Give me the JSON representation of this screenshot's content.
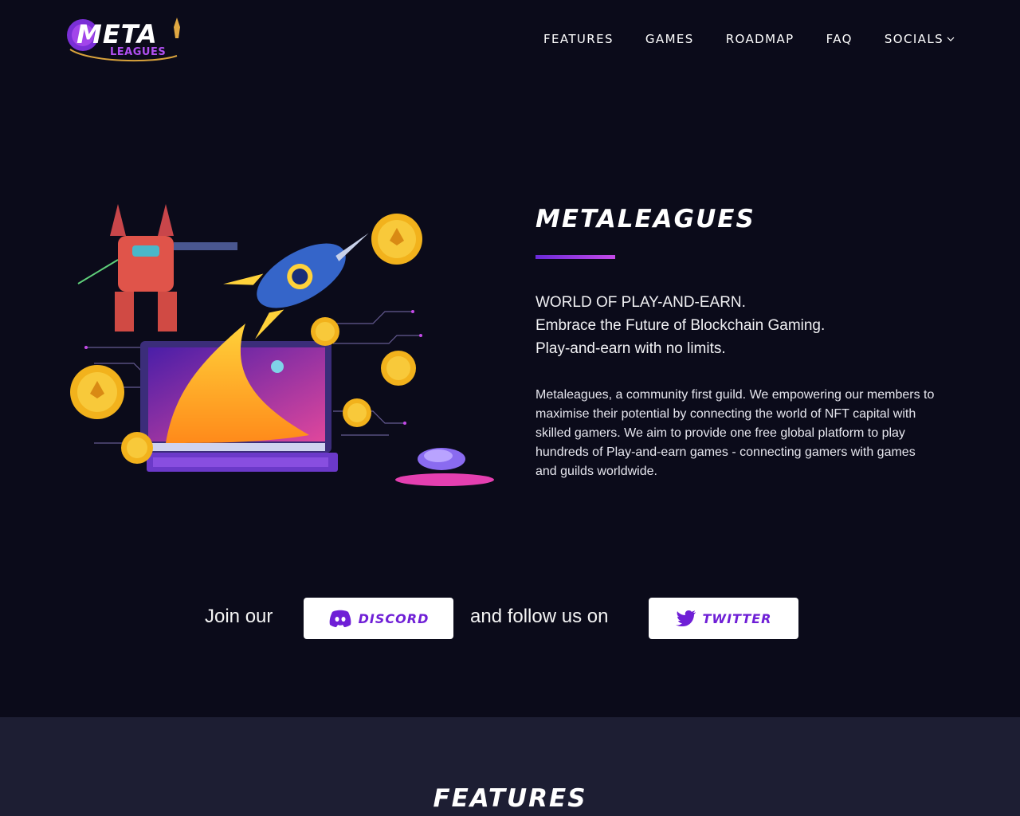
{
  "brand": {
    "name_main": "META",
    "name_sub": "LEAGUES"
  },
  "nav": {
    "items": [
      {
        "label": "FEATURES"
      },
      {
        "label": "GAMES"
      },
      {
        "label": "ROADMAP"
      },
      {
        "label": "FAQ"
      },
      {
        "label": "SOCIALS"
      }
    ]
  },
  "hero": {
    "title": "METALEAGUES",
    "tagline_1": "WORLD OF PLAY-AND-EARN.",
    "tagline_2": "Embrace the Future of Blockchain Gaming.",
    "tagline_3": "Play-and-earn with no limits.",
    "description": "Metaleagues, a community first guild. We empowering our members to maximise their potential by connecting the world of NFT capital with skilled gamers. We aim to provide one free global platform to play hundreds of Play-and-earn games - connecting gamers with games and guilds worldwide."
  },
  "join": {
    "prefix": "Join our",
    "discord_label": "DISCORD",
    "middle": "and follow us on",
    "twitter_label": "TWITTER"
  },
  "features": {
    "title": "FEATURES"
  },
  "colors": {
    "background": "#0b0b1a",
    "section_alt": "#1d1e33",
    "accent": "#6f1fd6",
    "accent_light": "#c44ae8"
  }
}
